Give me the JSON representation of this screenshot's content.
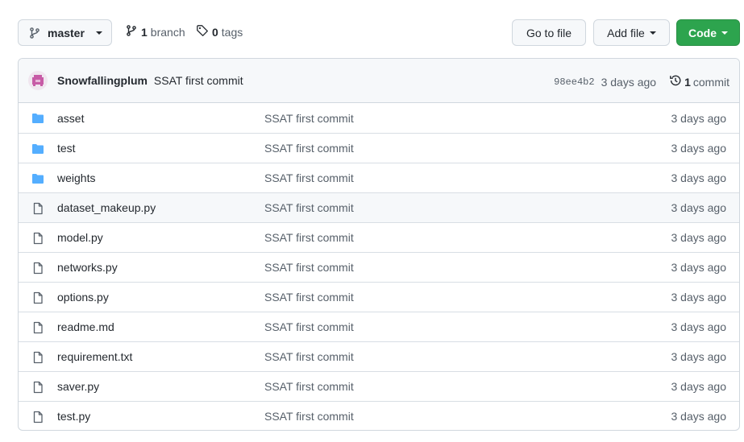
{
  "toolbar": {
    "branch_name": "master",
    "branch_count": "1",
    "branch_label": "branch",
    "tag_count": "0",
    "tag_label": "tags",
    "goto_file_label": "Go to file",
    "add_file_label": "Add file",
    "code_label": "Code"
  },
  "latest_commit": {
    "author": "Snowfallingplum",
    "message": "SSAT first commit",
    "sha": "98ee4b2",
    "age": "3 days ago",
    "commit_count": "1",
    "commit_label": "commit"
  },
  "files": [
    {
      "type": "folder-icon",
      "name": "asset",
      "message": "SSAT first commit",
      "age": "3 days ago"
    },
    {
      "type": "folder-icon",
      "name": "test",
      "message": "SSAT first commit",
      "age": "3 days ago"
    },
    {
      "type": "folder-icon",
      "name": "weights",
      "message": "SSAT first commit",
      "age": "3 days ago"
    },
    {
      "type": "file-icon",
      "name": "dataset_makeup.py",
      "message": "SSAT first commit",
      "age": "3 days ago"
    },
    {
      "type": "file-icon",
      "name": "model.py",
      "message": "SSAT first commit",
      "age": "3 days ago"
    },
    {
      "type": "file-icon",
      "name": "networks.py",
      "message": "SSAT first commit",
      "age": "3 days ago"
    },
    {
      "type": "file-icon",
      "name": "options.py",
      "message": "SSAT first commit",
      "age": "3 days ago"
    },
    {
      "type": "file-icon",
      "name": "readme.md",
      "message": "SSAT first commit",
      "age": "3 days ago"
    },
    {
      "type": "file-icon",
      "name": "requirement.txt",
      "message": "SSAT first commit",
      "age": "3 days ago"
    },
    {
      "type": "file-icon",
      "name": "saver.py",
      "message": "SSAT first commit",
      "age": "3 days ago"
    },
    {
      "type": "file-icon",
      "name": "test.py",
      "message": "SSAT first commit",
      "age": "3 days ago"
    }
  ],
  "colors": {
    "folder": "#54aeff",
    "file_icon": "#57606a",
    "code_button": "#2da44e",
    "avatar": "#c75ba6"
  }
}
